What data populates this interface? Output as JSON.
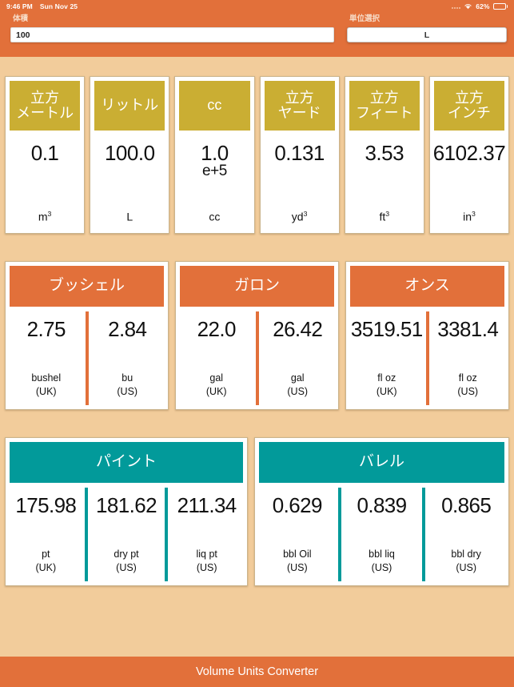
{
  "statusbar": {
    "time": "9:46 PM",
    "date": "Sun Nov 25",
    "battery_percent": "62%",
    "wifi_icon": "wifi-icon",
    "battery_icon": "battery-icon",
    "signal_icon": "signal-dots-icon"
  },
  "header": {
    "volume_label": "体積",
    "volume_value": "100",
    "volume_placeholder": "100",
    "unit_label": "単位選択",
    "unit_value": "L"
  },
  "colors": {
    "background": "#F2CC9B",
    "orange": "#E2703A",
    "gold": "#CAAE33",
    "teal": "#029A9A",
    "card": "#FFFFFF"
  },
  "row1": [
    {
      "title": "立方\nメートル",
      "value": "0.1",
      "exp": "",
      "unit": "m",
      "unit_sup": "3"
    },
    {
      "title": "リットル",
      "value": "100.0",
      "exp": "",
      "unit": "L",
      "unit_sup": ""
    },
    {
      "title": "cc",
      "value": "1.0",
      "exp": "e+5",
      "unit": "cc",
      "unit_sup": ""
    },
    {
      "title": "立方\nヤード",
      "value": "0.131",
      "exp": "",
      "unit": "yd",
      "unit_sup": "3"
    },
    {
      "title": "立方\nフィート",
      "value": "3.53",
      "exp": "",
      "unit": "ft",
      "unit_sup": "3"
    },
    {
      "title": "立方\nインチ",
      "value": "6102.37",
      "exp": "",
      "unit": "in",
      "unit_sup": "3"
    }
  ],
  "row2": [
    {
      "title": "ブッシェル",
      "cells": [
        {
          "value": "2.75",
          "label": "bushel\n(UK)"
        },
        {
          "value": "2.84",
          "label": "bu\n(US)"
        }
      ]
    },
    {
      "title": "ガロン",
      "cells": [
        {
          "value": "22.0",
          "label": "gal\n(UK)"
        },
        {
          "value": "26.42",
          "label": "gal\n(US)"
        }
      ]
    },
    {
      "title": "オンス",
      "cells": [
        {
          "value": "3519.51",
          "label": "fl oz\n(UK)"
        },
        {
          "value": "3381.4",
          "label": "fl oz\n(US)"
        }
      ]
    }
  ],
  "row3": [
    {
      "title": "パイント",
      "cells": [
        {
          "value": "175.98",
          "label": "pt\n(UK)"
        },
        {
          "value": "181.62",
          "label": "dry pt\n(US)"
        },
        {
          "value": "211.34",
          "label": "liq pt\n(US)"
        }
      ]
    },
    {
      "title": "バレル",
      "cells": [
        {
          "value": "0.629",
          "label": "bbl Oil\n(US)"
        },
        {
          "value": "0.839",
          "label": "bbl liq\n(US)"
        },
        {
          "value": "0.865",
          "label": "bbl dry\n(US)"
        }
      ]
    }
  ],
  "footer": {
    "title": "Volume Units Converter"
  }
}
